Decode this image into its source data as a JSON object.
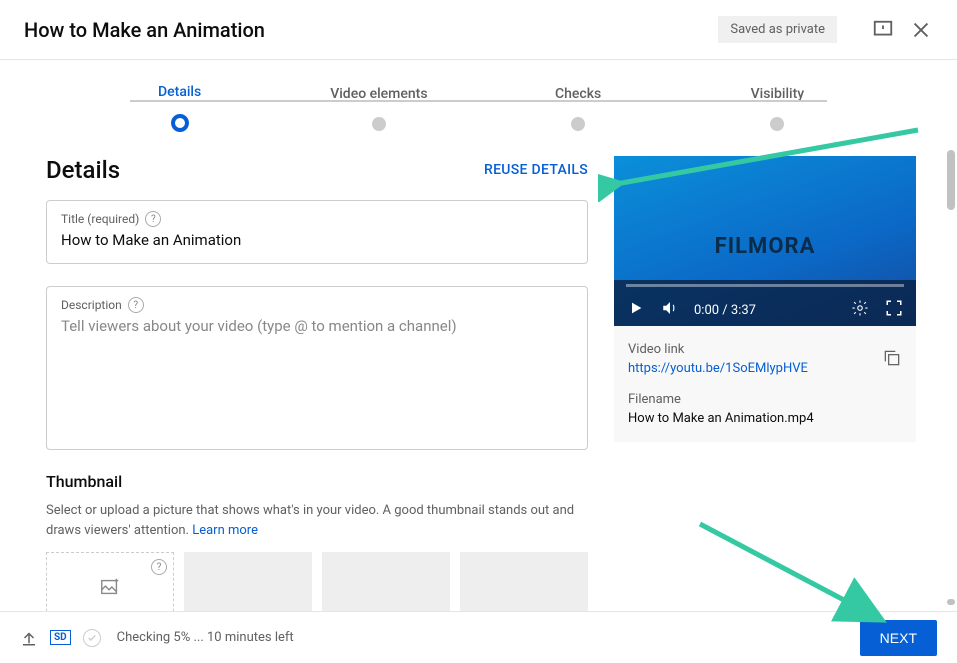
{
  "header": {
    "title": "How to Make an Animation",
    "saved_status": "Saved as private"
  },
  "stepper": {
    "steps": [
      {
        "label": "Details",
        "active": true
      },
      {
        "label": "Video elements",
        "active": false
      },
      {
        "label": "Checks",
        "active": false
      },
      {
        "label": "Visibility",
        "active": false
      }
    ]
  },
  "details": {
    "section_title": "Details",
    "reuse_label": "REUSE DETAILS",
    "title_field_label": "Title (required)",
    "title_value": "How to Make an Animation",
    "description_label": "Description",
    "description_placeholder": "Tell viewers about your video (type @ to mention a channel)",
    "thumbnail_title": "Thumbnail",
    "thumbnail_desc": "Select or upload a picture that shows what's in your video. A good thumbnail stands out and draws viewers' attention. ",
    "learn_more": "Learn more"
  },
  "preview": {
    "brand_text": "FILMORA",
    "time_current": "0:00",
    "time_total": "3:37",
    "video_link_label": "Video link",
    "video_link": "https://youtu.be/1SoEMlypHVE",
    "filename_label": "Filename",
    "filename": "How to Make an Animation.mp4"
  },
  "footer": {
    "sd_label": "SD",
    "status_text": "Checking 5% ... 10 minutes left",
    "next_label": "NEXT"
  }
}
